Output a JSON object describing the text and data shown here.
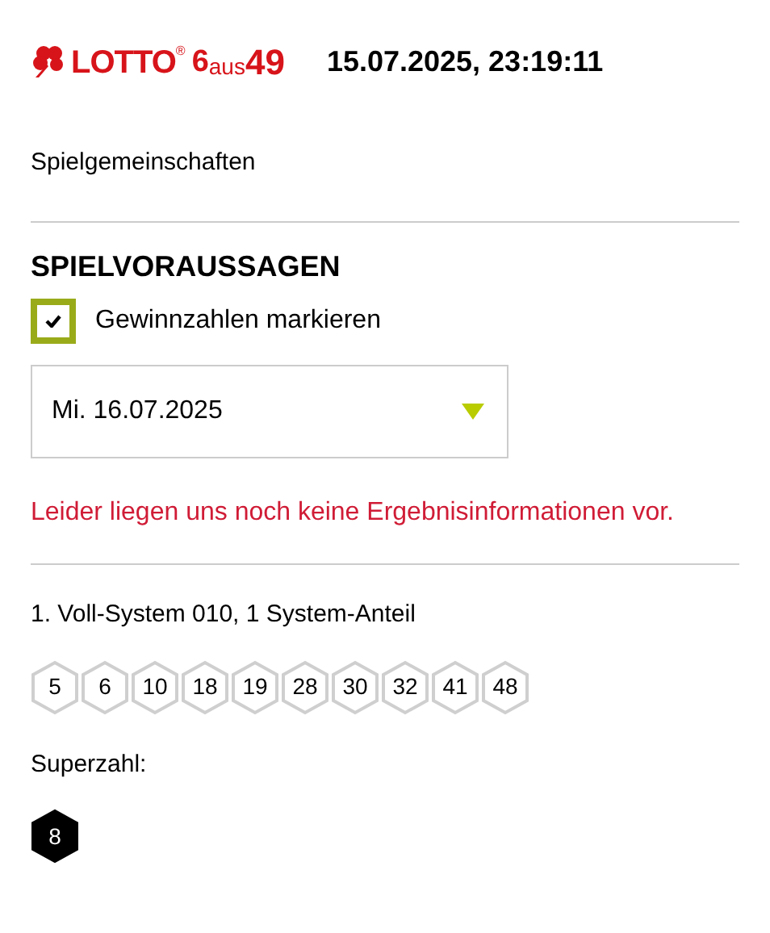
{
  "header": {
    "logo": {
      "brand": "LOTTO",
      "registered": "®",
      "six": "6",
      "aus": "aus",
      "fortynine": "49"
    },
    "datetime": "15.07.2025, 23:19:11"
  },
  "nav_link": "Spielgemeinschaften",
  "section_title": "SPIELVORAUSSAGEN",
  "checkbox": {
    "label": "Gewinnzahlen markieren",
    "checked": true
  },
  "date_select": {
    "value": "Mi. 16.07.2025"
  },
  "message": "Leider liegen uns noch keine Ergebnisinformationen vor.",
  "ticket": {
    "title": "1. Voll-System 010, 1 System-Anteil",
    "numbers": [
      "5",
      "6",
      "10",
      "18",
      "19",
      "28",
      "30",
      "32",
      "41",
      "48"
    ],
    "superzahl_label": "Superzahl:",
    "superzahl": "8"
  }
}
